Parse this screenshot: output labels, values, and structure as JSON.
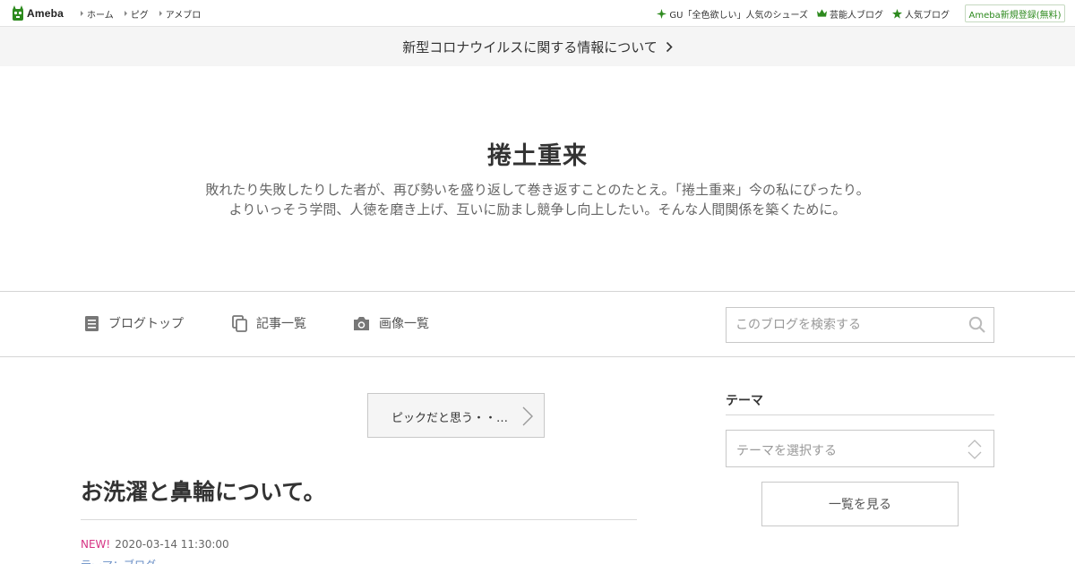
{
  "brand": {
    "logo_text": "Ameba",
    "colors": {
      "green": "#2d8a1e",
      "new": "#d63384",
      "link": "#6a8fc6"
    }
  },
  "topnav": {
    "items": [
      {
        "label": "ホーム"
      },
      {
        "label": "ピグ"
      },
      {
        "label": "アメブロ"
      }
    ],
    "links": [
      {
        "icon": "sparkle-icon",
        "label": "GU「全色欲しい」人気のシューズ"
      },
      {
        "icon": "crown-icon",
        "label": "芸能人ブログ"
      },
      {
        "icon": "star-icon",
        "label": "人気ブログ"
      }
    ],
    "signup_label": "Ameba新規登録(無料)"
  },
  "notice": {
    "label": "新型コロナウイルスに関する情報について"
  },
  "blog": {
    "title": "捲土重来",
    "description_line1": "敗れたり失敗したりした者が、再び勢いを盛り返して巻き返すことのたとえ。「捲土重来」今の私にぴったり。",
    "description_line2": "よりいっそう学問、人徳を磨き上げ、互いに励まし競争し向上したい。そんな人間関係を築くために。"
  },
  "blognav": {
    "items": [
      {
        "icon": "document-icon",
        "label": "ブログトップ"
      },
      {
        "icon": "copy-icon",
        "label": "記事一覧"
      },
      {
        "icon": "camera-icon",
        "label": "画像一覧"
      }
    ],
    "search_placeholder": "このブログを検索する"
  },
  "entry": {
    "prev_label": "ピックだと思う・・…",
    "title": "お洗濯と鼻輪について。",
    "new_badge": "NEW!",
    "date": "2020-03-14 11:30:00",
    "theme_label": "テーマ：ブログ"
  },
  "sidebar": {
    "heading": "テーマ",
    "select_placeholder": "テーマを選択する",
    "list_button": "一覧を見る"
  }
}
